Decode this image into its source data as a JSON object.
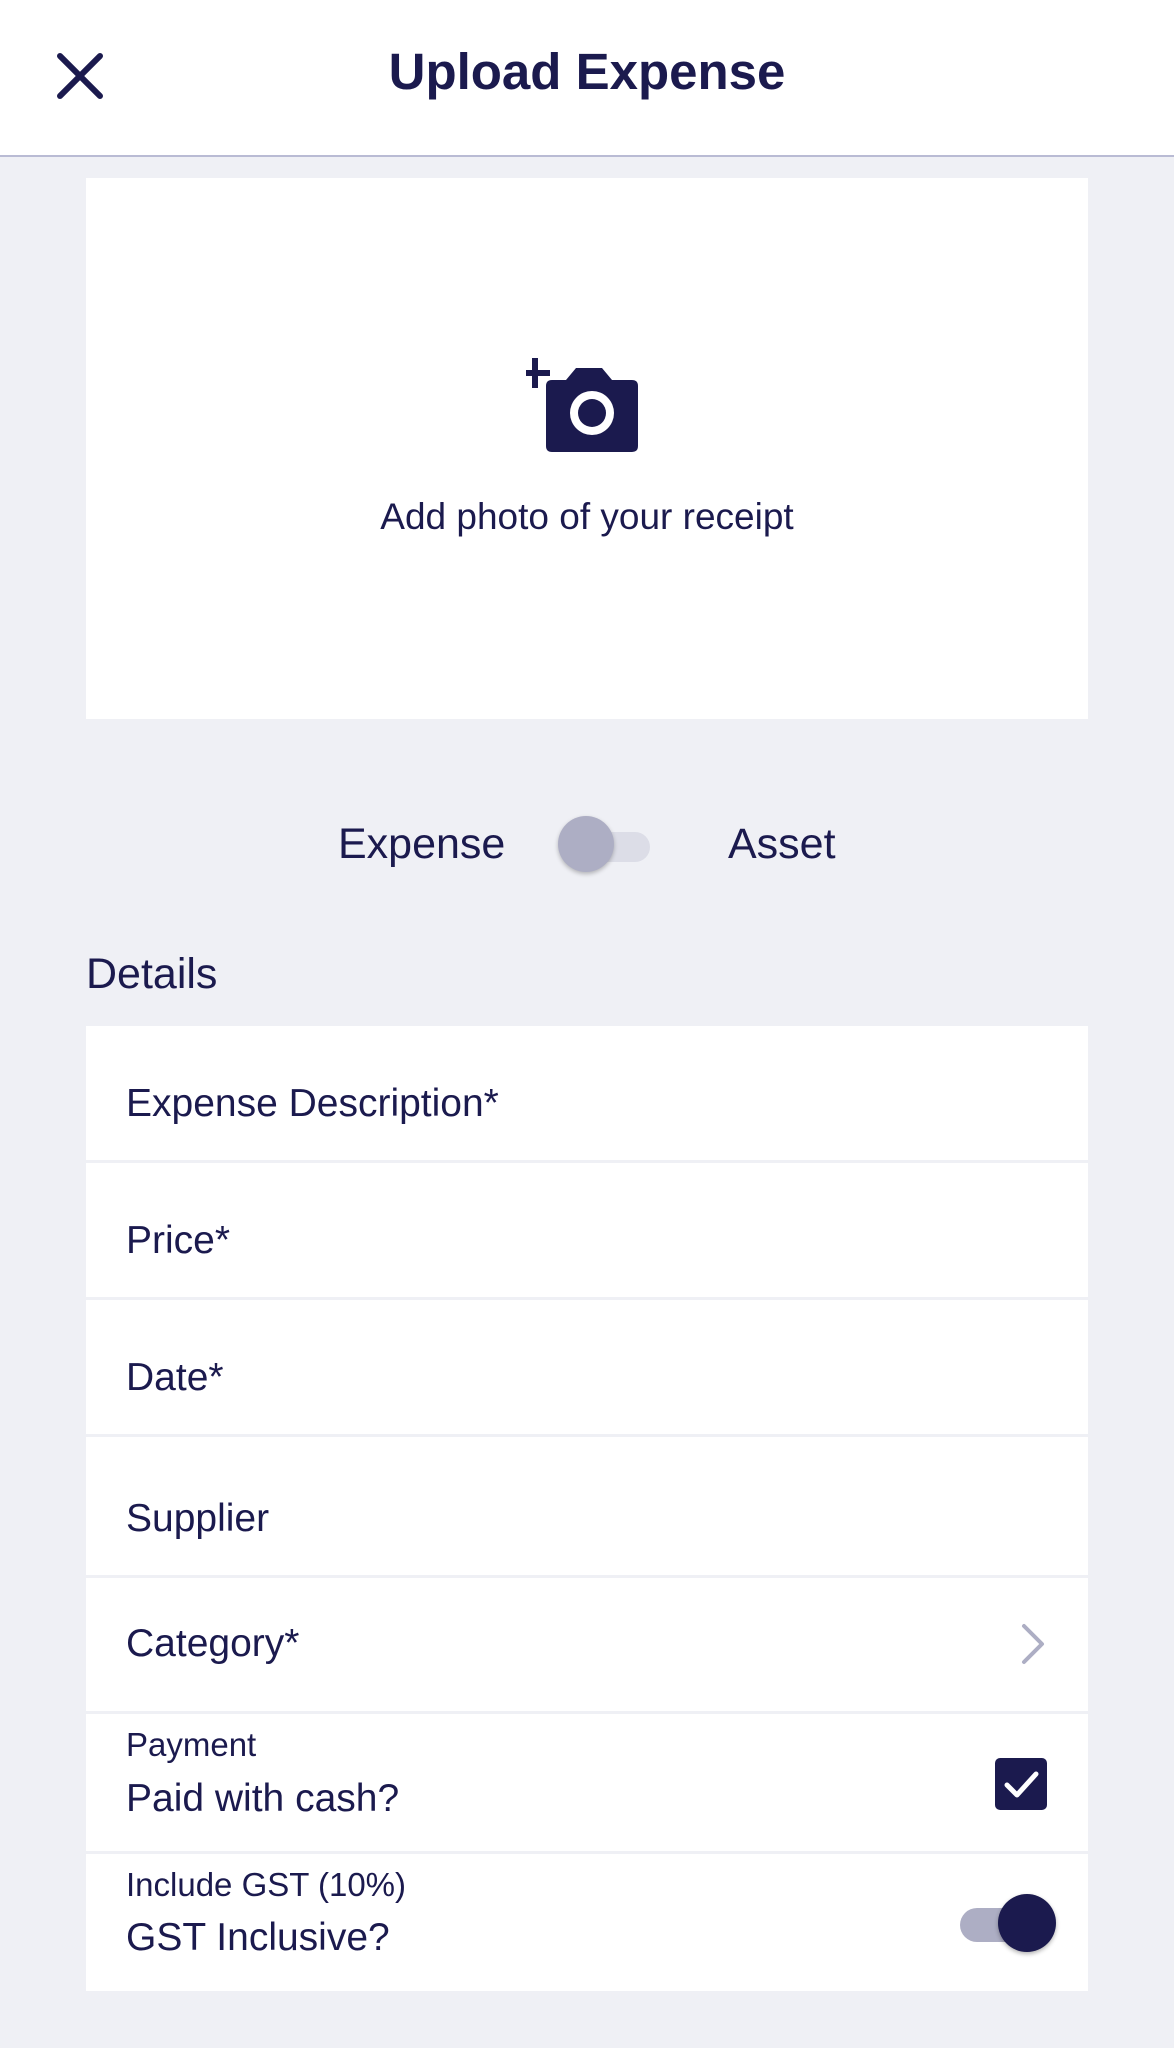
{
  "header": {
    "title": "Upload Expense",
    "close_icon": "close-icon"
  },
  "receipt": {
    "icon": "add-photo-camera-icon",
    "label": "Add photo of your receipt"
  },
  "type_toggle": {
    "left_label": "Expense",
    "right_label": "Asset",
    "selected": "Expense"
  },
  "details": {
    "section_title": "Details",
    "fields": {
      "description": "Expense Description*",
      "price": "Price*",
      "date": "Date*",
      "supplier": "Supplier",
      "category": "Category*"
    },
    "payment": {
      "caption": "Payment",
      "label": "Paid with cash?",
      "checked": true
    },
    "gst": {
      "caption": "Include GST (10%)",
      "label": "GST Inclusive?",
      "on": true
    }
  },
  "colors": {
    "primary": "#1b1a4e",
    "background": "#eff0f5",
    "muted": "#adaec4"
  }
}
